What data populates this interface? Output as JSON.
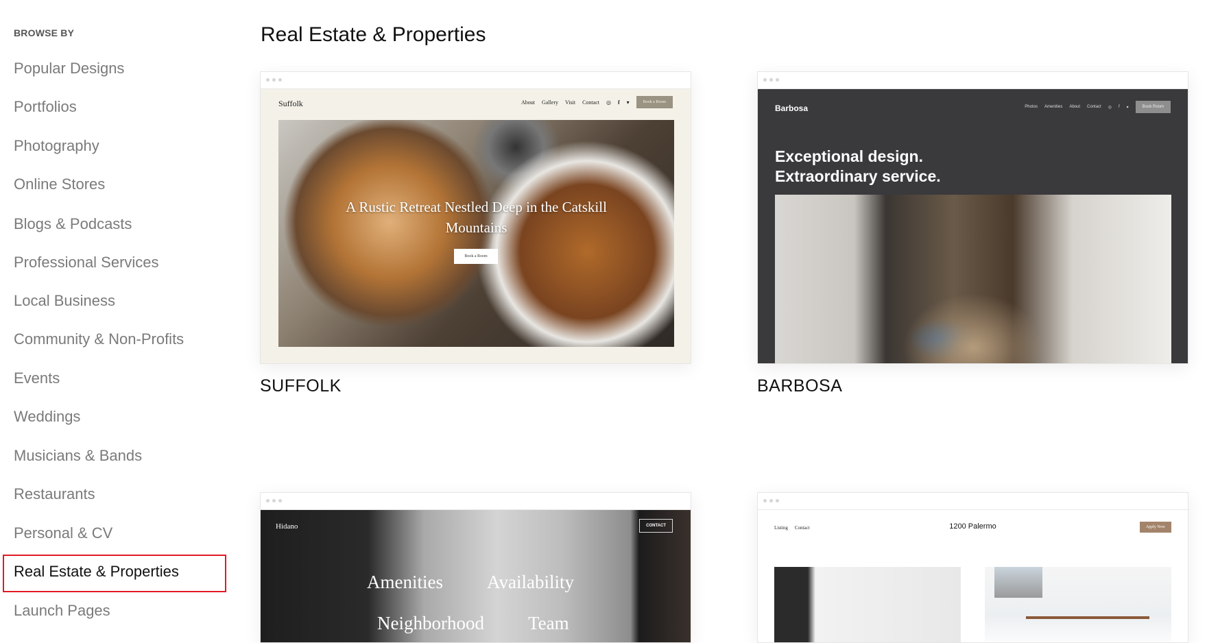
{
  "sidebar": {
    "heading": "BROWSE BY",
    "items": [
      "Popular Designs",
      "Portfolios",
      "Photography",
      "Online Stores",
      "Blogs & Podcasts",
      "Professional Services",
      "Local Business",
      "Community & Non-Profits",
      "Events",
      "Weddings",
      "Musicians & Bands",
      "Restaurants",
      "Personal & CV",
      "Real Estate & Properties",
      "Launch Pages"
    ],
    "active": "Real Estate & Properties",
    "active_color": "#e01b24"
  },
  "main": {
    "title": "Real Estate & Properties",
    "templates": [
      {
        "name": "SUFFOLK",
        "brand": "Suffolk",
        "nav": [
          "About",
          "Gallery",
          "Visit",
          "Contact"
        ],
        "cta": "Book a Room",
        "headline": "A Rustic Retreat Nestled Deep in the Catskill Mountains",
        "hero_button": "Book a Room",
        "bg": "#f3f1e8"
      },
      {
        "name": "BARBOSA",
        "brand": "Barbosa",
        "nav": [
          "Photos",
          "Amenities",
          "About",
          "Contact"
        ],
        "cta": "Book Room",
        "headline_line1": "Exceptional design.",
        "headline_line2": "Extraordinary service.",
        "bg": "#3a393c"
      },
      {
        "brand": "Hidano",
        "cta": "CONTACT",
        "links": [
          "Amenities",
          "Availability",
          "Neighborhood",
          "Team"
        ]
      },
      {
        "brand": "1200 Palermo",
        "nav": [
          "Listing",
          "Contact"
        ],
        "cta": "Apply Now"
      }
    ]
  }
}
